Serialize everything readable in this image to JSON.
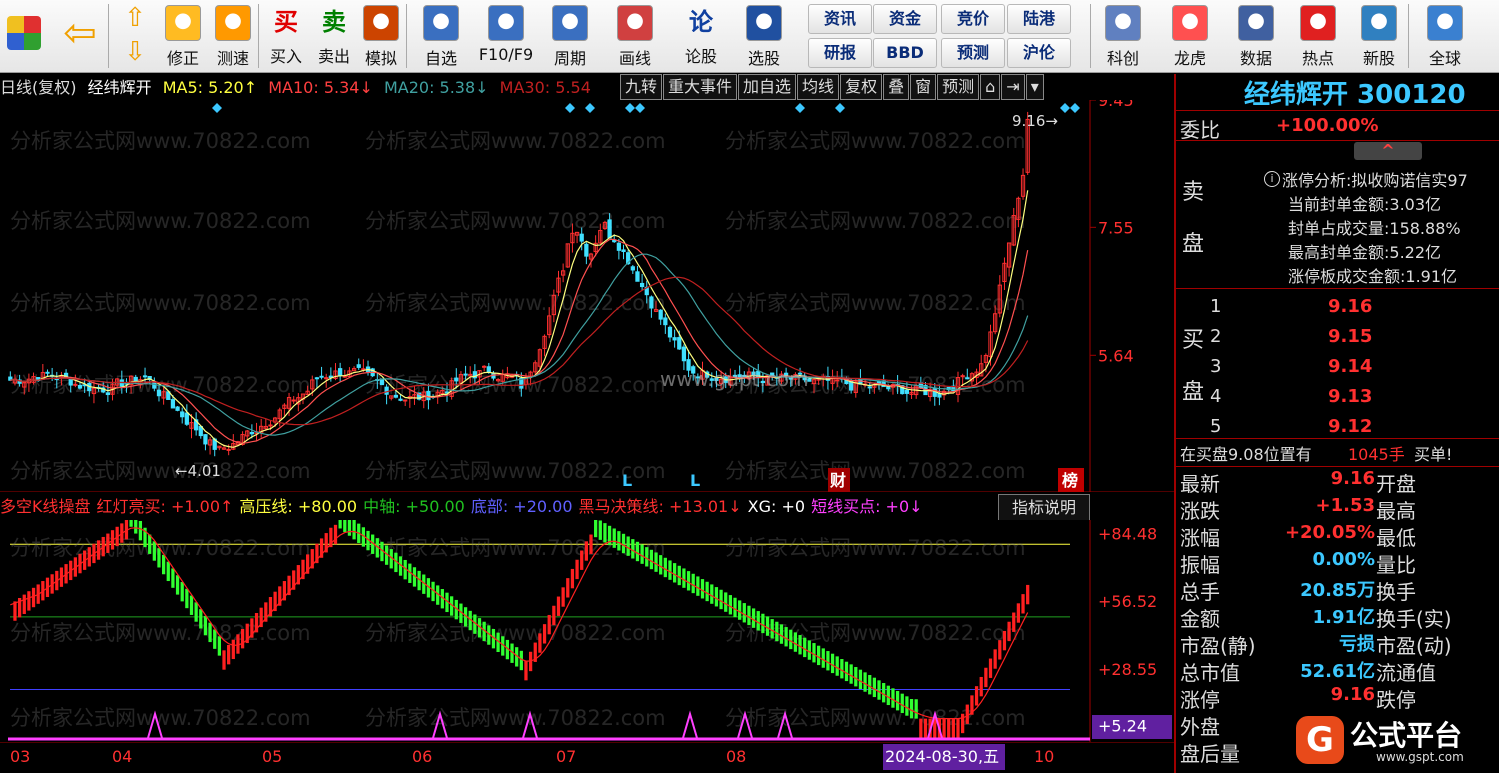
{
  "toolbar": {
    "items": [
      {
        "label": "",
        "icon": "windows-grid-icon"
      },
      {
        "label": "",
        "icon": "back-arrow-icon"
      },
      {
        "label": "修正",
        "icon": "refresh-icon"
      },
      {
        "label": "测速",
        "icon": "clock-icon"
      },
      {
        "label": "买入",
        "icon": "buy-icon",
        "glyph": "买"
      },
      {
        "label": "卖出",
        "icon": "sell-icon",
        "glyph": "卖"
      },
      {
        "label": "模拟",
        "icon": "gavel-icon"
      },
      {
        "label": "自选",
        "icon": "star-folder-icon"
      },
      {
        "label": "F10/F9",
        "icon": "f10-icon"
      },
      {
        "label": "周期",
        "icon": "period-clock-icon"
      },
      {
        "label": "画线",
        "icon": "pencil-icon"
      },
      {
        "label": "论股",
        "icon": "forum-icon",
        "glyph": "论"
      },
      {
        "label": "选股",
        "icon": "stock-pick-icon"
      },
      {
        "label": "科创",
        "icon": "tech-board-icon"
      },
      {
        "label": "龙虎",
        "icon": "dragon-tiger-icon"
      },
      {
        "label": "数据",
        "icon": "pe-data-icon"
      },
      {
        "label": "热点",
        "icon": "hot-icon"
      },
      {
        "label": "新股",
        "icon": "ipo-icon"
      },
      {
        "label": "全球",
        "icon": "globe-icon"
      }
    ],
    "small_buttons": [
      "资讯",
      "资金",
      "竞价",
      "陆港",
      "研报",
      "BBD",
      "预测",
      "沪伦"
    ]
  },
  "main_header": {
    "period": "日线(复权)",
    "name": "经纬辉开",
    "ma5": "MA5: 5.20↑",
    "ma10": "MA10: 5.34↓",
    "ma20": "MA20: 5.38↓",
    "ma30": "MA30: 5.54",
    "buttons": [
      "九转",
      "重大事件",
      "加自选",
      "均线",
      "复权",
      "叠",
      "窗",
      "预测"
    ]
  },
  "main_chart": {
    "price_labels": [
      "9.45",
      "7.55",
      "5.64"
    ],
    "last_price_tag": "9.16→",
    "low_tag": "←4.01",
    "markers": [
      "L",
      "L",
      "财",
      "榜"
    ],
    "watermark": "分析家公式网www.70822.com",
    "center_watermark": "www.gupt.com"
  },
  "indicator": {
    "header": [
      {
        "text": "多空K线操盘",
        "color": "#ff3030"
      },
      {
        "text": "红灯亮买: +1.00↑",
        "color": "#ff3030"
      },
      {
        "text": "高压线: +80.00",
        "color": "#ffff40"
      },
      {
        "text": "中轴: +50.00",
        "color": "#20c020"
      },
      {
        "text": "底部: +20.00",
        "color": "#6060ff"
      },
      {
        "text": "黑马决策线: +13.01↓",
        "color": "#ff3030"
      },
      {
        "text": "XG: +0",
        "color": "#ffffff"
      },
      {
        "text": "短线买点: +0↓",
        "color": "#ff40ff"
      }
    ],
    "help_button": "指标说明",
    "axis_labels": [
      "+84.48",
      "+56.52",
      "+28.55",
      "+5.24"
    ]
  },
  "date_axis": {
    "labels": [
      "03",
      "04",
      "05",
      "06",
      "07",
      "08",
      "2024-08-30,五",
      "10"
    ]
  },
  "quote": {
    "title": "经纬辉开 300120",
    "weibi_label": "委比",
    "weibi_value": "+100.00%",
    "sell_label": "卖盘",
    "limit_info": [
      "涨停分析:拟收购诺信实97",
      "当前封单金额:3.03亿",
      "封单占成交量:158.88%",
      "最高封单金额:5.22亿",
      "涨停板成交金额:1.91亿"
    ],
    "buy_label": "买盘",
    "bids": [
      {
        "level": "1",
        "price": "9.16"
      },
      {
        "level": "2",
        "price": "9.15"
      },
      {
        "level": "3",
        "price": "9.14"
      },
      {
        "level": "4",
        "price": "9.13"
      },
      {
        "level": "5",
        "price": "9.12"
      }
    ],
    "notice": {
      "text": "在买盘9.08位置有",
      "volume": "1045手",
      "tail": "买单!"
    },
    "stats": [
      {
        "label": "最新",
        "value": "9.16",
        "label2": "开盘"
      },
      {
        "label": "涨跌",
        "value": "+1.53",
        "label2": "最高"
      },
      {
        "label": "涨幅",
        "value": "+20.05%",
        "label2": "最低"
      },
      {
        "label": "振幅",
        "value": "0.00%",
        "label2": "量比"
      },
      {
        "label": "总手",
        "value": "20.85万",
        "label2": "换手"
      },
      {
        "label": "金额",
        "value": "1.91亿",
        "label2": "换手(实)"
      },
      {
        "label": "市盈(静)",
        "value": "亏损",
        "label2": "市盈(动)"
      },
      {
        "label": "总市值",
        "value": "52.61亿",
        "label2": "流通值"
      },
      {
        "label": "涨停",
        "value": "9.16",
        "label2": "跌停"
      },
      {
        "label": "外盘",
        "value": "",
        "label2": ""
      },
      {
        "label": "盘后量",
        "value": "",
        "label2": ""
      }
    ],
    "brand": "公式平台",
    "brand_url": "www.gspt.com"
  }
}
